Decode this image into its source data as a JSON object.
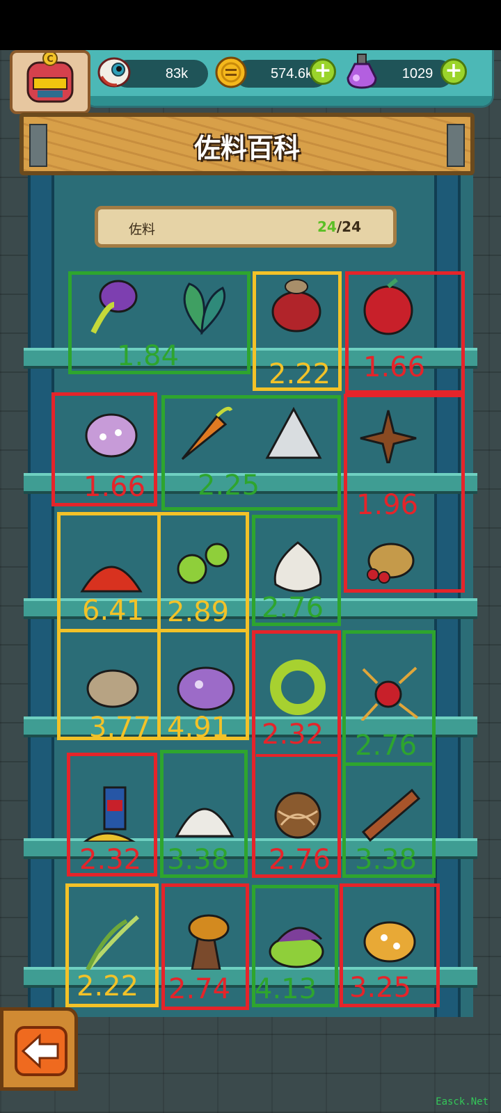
{
  "currencies": {
    "eyeballs": "83k",
    "coins": "574.6k",
    "potions": "1029"
  },
  "page_title": "佐料百科",
  "collection": {
    "label": "佐料",
    "collected": "24",
    "separator": "/",
    "total": "24"
  },
  "values": {
    "v1": "1.84",
    "v2": "2.22",
    "v3": "1.66",
    "v4": "1.66",
    "v5": "2.25",
    "v6": "1.96",
    "v7": "6.41",
    "v8": "2.89",
    "v9": "2.76",
    "v10": "3.77",
    "v11": "4.91",
    "v12": "2.32",
    "v13": "2.76",
    "v14": "2.32",
    "v15": "3.38",
    "v16": "2.76",
    "v17": "3.38",
    "v18": "2.22",
    "v19": "2.74",
    "v20": "4.13",
    "v21": "3.25"
  },
  "watermark": "Easck.Net",
  "colors": {
    "green": "#2ea52e",
    "yellow": "#f3c228",
    "red": "#e5242a"
  },
  "icons": {
    "eyeball": "eyeball-icon",
    "coin": "coin-icon",
    "potion": "potion-icon",
    "back": "back-arrow-icon"
  }
}
